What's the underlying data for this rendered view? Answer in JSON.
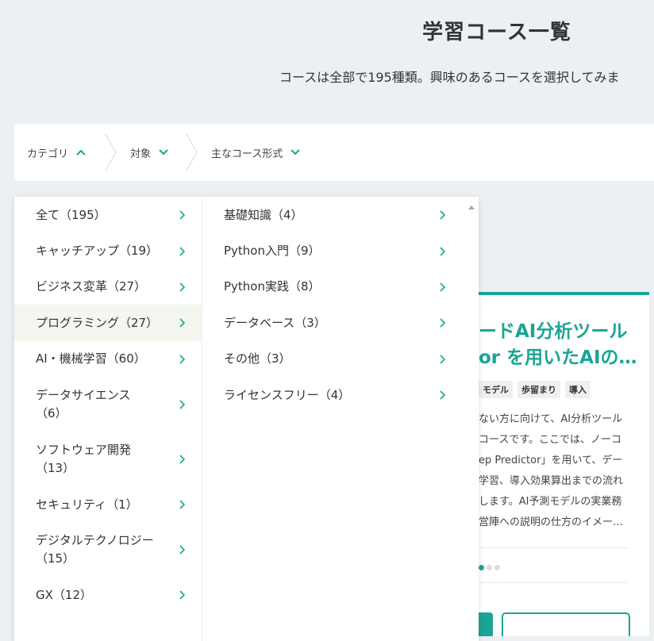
{
  "header": {
    "title": "学習コース一覧",
    "subtitle": "コースは全部で195種類。興味のあるコースを選択してみま"
  },
  "filters": [
    {
      "label": "カテゴリ",
      "icon": "chevron-up-icon"
    },
    {
      "label": "対象",
      "icon": "chevron-down-icon"
    },
    {
      "label": "主なコース形式",
      "icon": "chevron-down-icon"
    }
  ],
  "categories": [
    {
      "label": "全て（195）"
    },
    {
      "label": "キャッチアップ（19）"
    },
    {
      "label": "ビジネス変革（27）"
    },
    {
      "label": "プログラミング（27）"
    },
    {
      "label": "AI・機械学習（60）"
    },
    {
      "label": "データサイエンス",
      "label2": "（6）"
    },
    {
      "label": "ソフトウェア開発",
      "label2": "（13）"
    },
    {
      "label": "セキュリティ（1）"
    },
    {
      "label": "デジタルテクノロジー",
      "label2": "（15）"
    },
    {
      "label": "GX（12）"
    }
  ],
  "subcategories": [
    {
      "label": "基礎知識（4）"
    },
    {
      "label": "Python入門（9）"
    },
    {
      "label": "Python実践（8）"
    },
    {
      "label": "データベース（3）"
    },
    {
      "label": "その他（3）"
    },
    {
      "label": "ライセンスフリー（4）"
    }
  ],
  "card": {
    "title_line1": "ードAI分析ツール",
    "title_line2": "or を用いたAIの…",
    "tags": [
      "モデル",
      "歩留まり",
      "導入"
    ],
    "desc": [
      "ない方に向けて、AI分析ツール",
      "コースです。ここでは、ノーコ",
      "ep Predictor」を用いて、デー",
      "学習、導入効果算出までの流れ",
      "します。AI予測モデルの実業務",
      "営陣への説明の仕方のイメー…"
    ]
  },
  "colors": {
    "accent": "#1aa594",
    "background": "#ecf0f3",
    "active_row": "#f3f7ef"
  }
}
